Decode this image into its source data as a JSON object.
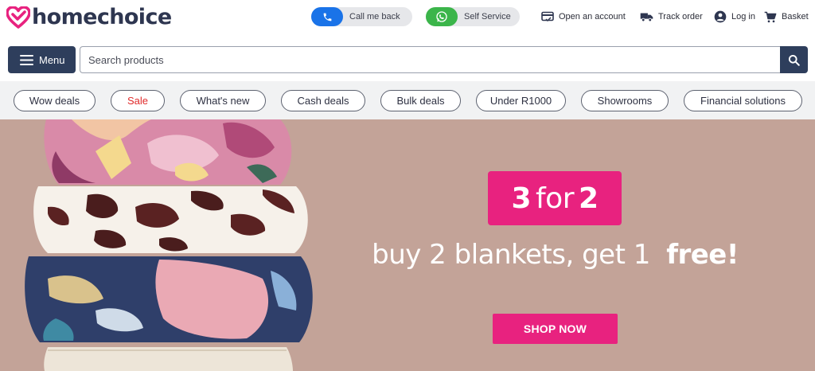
{
  "brand": {
    "name": "homechoice",
    "color": "#e8227f",
    "text_color": "#2e3650"
  },
  "contact": {
    "call_label": "Call me back",
    "self_service_label": "Self Service"
  },
  "utility_nav": {
    "open_account": "Open an account",
    "track_order": "Track order",
    "login": "Log in",
    "basket": "Basket"
  },
  "search": {
    "menu_label": "Menu",
    "placeholder": "Search products"
  },
  "categories": [
    {
      "label": "Wow deals"
    },
    {
      "label": "Sale",
      "color": "#e02a2a"
    },
    {
      "label": "What's new"
    },
    {
      "label": "Cash deals"
    },
    {
      "label": "Bulk deals"
    },
    {
      "label": "Under R1000"
    },
    {
      "label": "Showrooms"
    },
    {
      "label": "Financial solutions"
    }
  ],
  "hero": {
    "badge_num1": "3",
    "badge_word": "for",
    "badge_num2": "2",
    "headline": "buy 2 blankets, get 1",
    "headline_emphasis": "free!",
    "cta_label": "SHOP NOW",
    "background": "#c3a398",
    "accent": "#e8227f"
  }
}
